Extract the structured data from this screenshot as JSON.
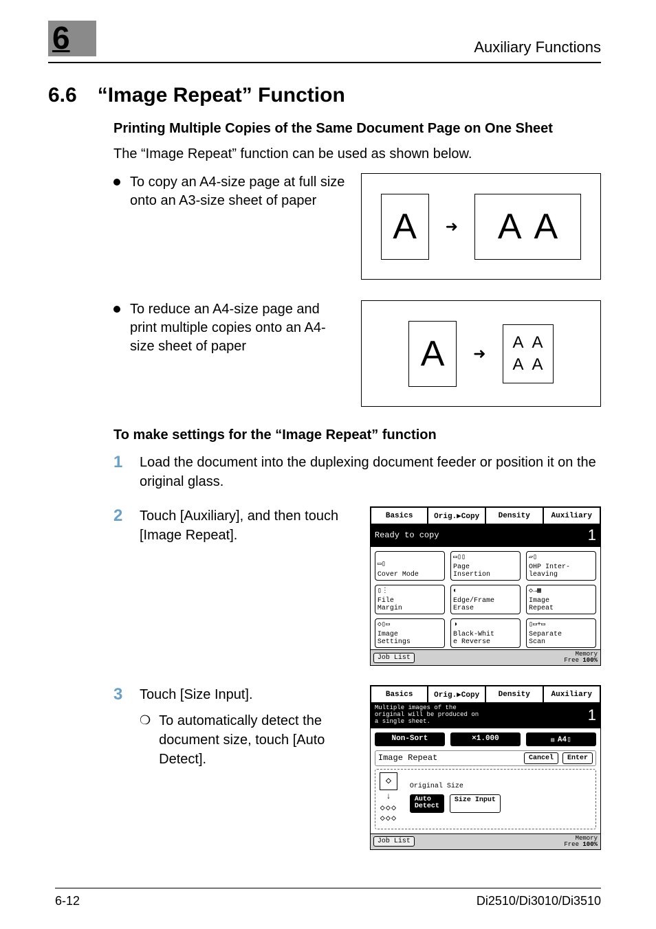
{
  "header": {
    "chapter_num": "6",
    "aux_title": "Auxiliary Functions"
  },
  "section": {
    "number": "6.6",
    "title": "“Image Repeat” Function"
  },
  "sub1_title": "Printing Multiple Copies of the Same Document Page on One Sheet",
  "intro": "The “Image Repeat” function can be used as shown below.",
  "bullet1": "To copy an A4-size page at full size onto an A3-size sheet of paper",
  "bullet2": "To reduce an A4-size page and print multiple copies onto an A4-size sheet of paper",
  "diagram": {
    "A": "A",
    "arrow": "➜"
  },
  "sub2_title": "To make settings for the “Image Repeat” function",
  "steps": {
    "s1_num": "1",
    "s1": "Load the document into the duplexing document feeder or position it on the original glass.",
    "s2_num": "2",
    "s2": "Touch [Auxiliary], and then touch [Image Repeat].",
    "s3_num": "3",
    "s3": "Touch [Size Input].",
    "s3_sub_mark": "❘",
    "s3_sub": "To automatically detect the document size, touch [Auto Detect]."
  },
  "screen1": {
    "tabs": {
      "t1": "Basics",
      "t2": "Orig.▶Copy",
      "t3": "Density",
      "t4": "Auxiliary"
    },
    "status": "Ready to copy",
    "count": "1",
    "buttons": {
      "b1": "Cover Mode",
      "b2": "Page\nInsertion",
      "b3": "OHP Inter-\nleaving",
      "b4": "File\nMargin",
      "b5": "Edge/Frame\nErase",
      "b6": "Image\nRepeat",
      "b7": "Image\nSettings",
      "b8": "Black-Whit\ne Reverse",
      "b9": "Separate\nScan"
    },
    "footer": {
      "job": "Job List",
      "mem1": "Memory",
      "mem2": "Free",
      "mem3": "100%"
    }
  },
  "screen2": {
    "tabs": {
      "t1": "Basics",
      "t2": "Orig.▶Copy",
      "t3": "Density",
      "t4": "Auxiliary"
    },
    "status": "Multiple images of the\noriginal will be produced on\na single sheet.",
    "count": "1",
    "row": {
      "r1": "Non-Sort",
      "r2": "×1.000",
      "r3": "A4▯"
    },
    "panel_title": "Image Repeat",
    "cancel": "Cancel",
    "enter": "Enter",
    "orig_title": "Original Size",
    "auto": "Auto\nDetect",
    "size_input": "Size Input",
    "footer": {
      "job": "Job List",
      "mem1": "Memory",
      "mem2": "Free",
      "mem3": "100%"
    }
  },
  "footer": {
    "page": "6-12",
    "model": "Di2510/Di3010/Di3510"
  }
}
